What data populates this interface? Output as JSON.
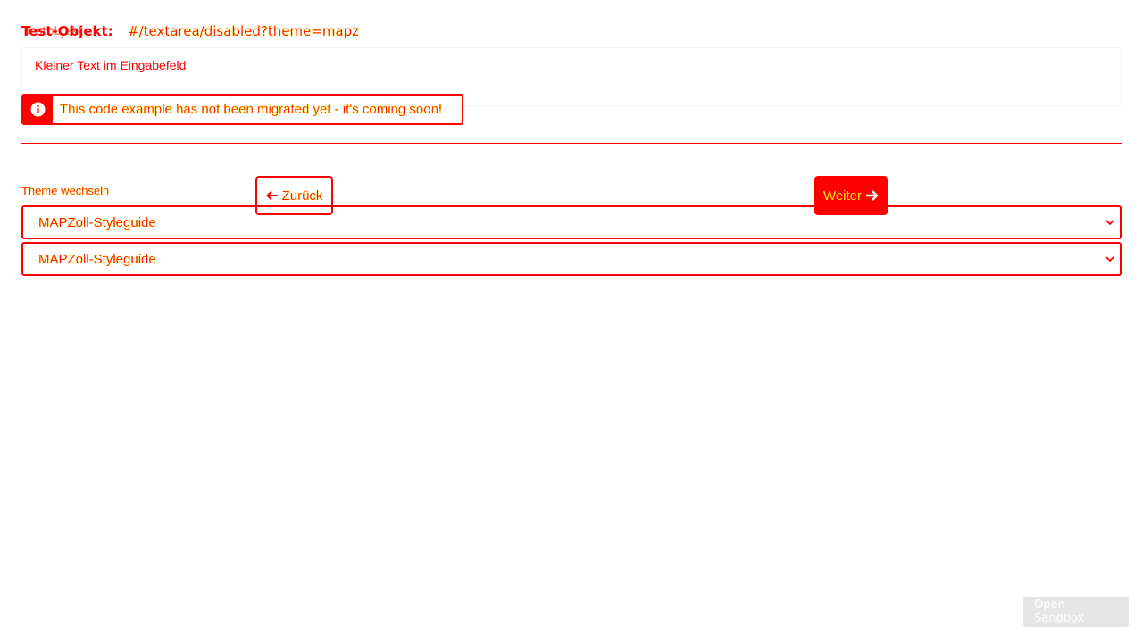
{
  "header": {
    "test_object_label": "Test-Objekt:",
    "test_object_value": "#/textarea/disabled?theme=mapz",
    "ghost_label": "Testobjekt"
  },
  "textarea": {
    "value": "Kleiner Text im Eingabefeld"
  },
  "info_note": {
    "icon": "info-icon",
    "text": "This code example has not been migrated yet - it's coming soon!"
  },
  "navigation": {
    "back_label": "Zurück",
    "back_icon": "arrow-left-icon",
    "next_label": "Weiter",
    "next_icon": "arrow-right-icon"
  },
  "theme": {
    "label": "Theme wechseln",
    "selected_primary": "MAPZoll-Styleguide",
    "selected_secondary": "MAPZoll-Styleguide"
  },
  "sandbox": {
    "label": "Open Sandbox"
  },
  "colors": {
    "accent": "#ff0000",
    "text_highlight": "#ffe000",
    "sandbox_bg": "#e6e6e6"
  }
}
